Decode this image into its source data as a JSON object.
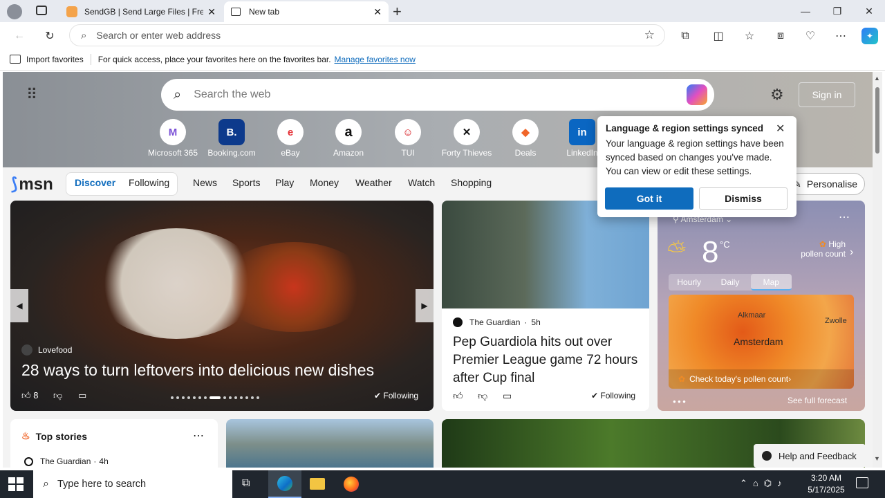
{
  "browser": {
    "tabs": [
      {
        "title": "SendGB | Send Large Files | Free f",
        "active": false
      },
      {
        "title": "New tab",
        "active": true
      }
    ],
    "address_placeholder": "Search or enter web address",
    "favorites_bar": {
      "import_label": "Import favorites",
      "message": "For quick access, place your favorites here on the favorites bar.",
      "manage_link": "Manage favorites now"
    }
  },
  "newtab": {
    "search_placeholder": "Search the web",
    "sign_in": "Sign in",
    "quick_links": [
      {
        "label": "Microsoft 365",
        "icon": "M"
      },
      {
        "label": "Booking.com",
        "icon": "B."
      },
      {
        "label": "eBay",
        "icon": "e"
      },
      {
        "label": "Amazon",
        "icon": "a"
      },
      {
        "label": "TUI",
        "icon": "☺"
      },
      {
        "label": "Forty Thieves",
        "icon": "✕"
      },
      {
        "label": "Deals",
        "icon": "◆"
      },
      {
        "label": "LinkedIn",
        "icon": "in"
      }
    ],
    "msn": {
      "logo": "msn",
      "pills": [
        "Discover",
        "Following"
      ],
      "nav": [
        "News",
        "Sports",
        "Play",
        "Money",
        "Weather",
        "Watch",
        "Shopping"
      ],
      "personalise": "Personalise"
    },
    "main_card": {
      "source": "Lovefood",
      "headline": "28 ways to turn leftovers into delicious new dishes",
      "likes": "8",
      "following": "Following"
    },
    "news_card": {
      "source": "The Guardian",
      "age": "5h",
      "headline": "Pep Guardiola hits out over Premier League game 72 hours after Cup final",
      "following": "Following"
    },
    "weather": {
      "city": "Amsterdam",
      "temp": "8",
      "unit": "°C",
      "pollen_title": "High",
      "pollen_sub": "pollen count",
      "tabs": [
        "Hourly",
        "Daily",
        "Map"
      ],
      "map_labels": [
        "Alkmaar",
        "Zwolle",
        "Amsterdam"
      ],
      "pollen_cta": "Check today's pollen count",
      "forecast_link": "See full forecast"
    },
    "top_stories": {
      "title": "Top stories",
      "first_source": "The Guardian",
      "first_age": "4h"
    },
    "help": "Help and Feedback",
    "popup": {
      "title": "Language & region settings synced",
      "body": "Your language & region settings have been synced based on changes you've made. You can view or edit these settings.",
      "primary": "Got it",
      "secondary": "Dismiss"
    }
  },
  "taskbar": {
    "search_placeholder": "Type here to search",
    "time": "3:20 AM",
    "date": "5/17/2025"
  },
  "colors": {
    "accent": "#0f6cbd",
    "taskbar": "#20262e"
  }
}
